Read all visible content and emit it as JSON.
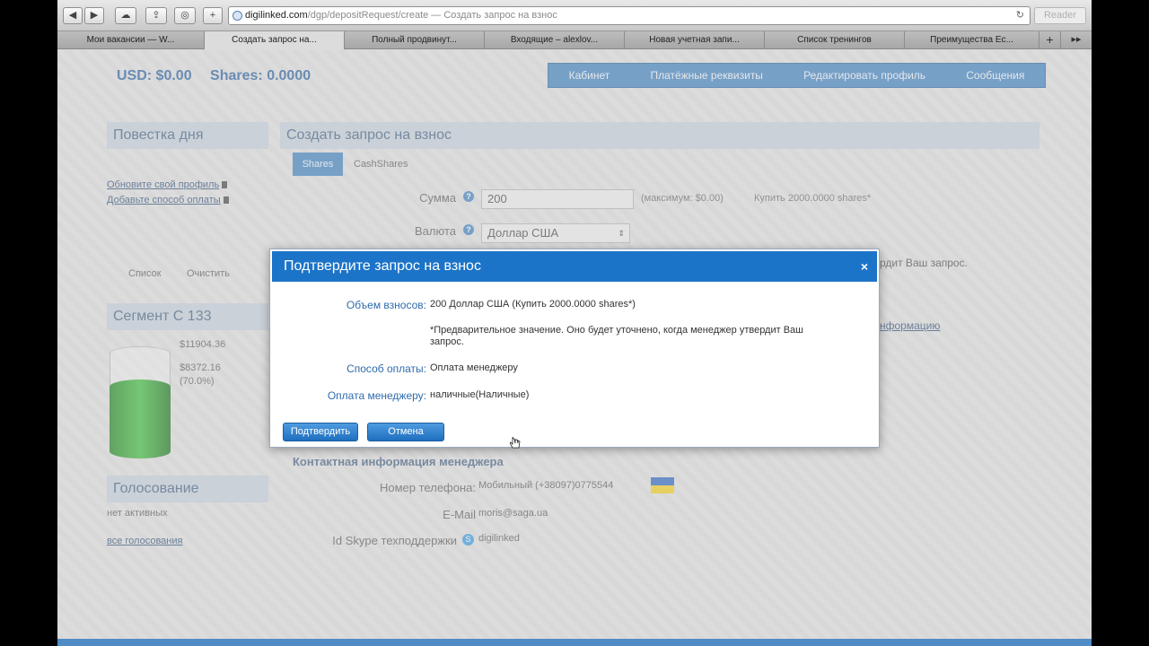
{
  "browser": {
    "url_host": "digilinked.com",
    "url_rest": "/dgp/depositRequest/create — Создать запрос на взнос",
    "reader_label": "Reader",
    "tabs": [
      {
        "label": "Мои вакансии — W..."
      },
      {
        "label": "Создать запрос на..."
      },
      {
        "label": "Полный продвинут..."
      },
      {
        "label": "Входящие – alexlov..."
      },
      {
        "label": "Новая учетная запи..."
      },
      {
        "label": "Список тренингов"
      },
      {
        "label": "Преимущества Ec..."
      }
    ],
    "new_tab_label": "+"
  },
  "header": {
    "usd": "USD: $0.00",
    "shares": "Shares: 0.0000"
  },
  "topnav": [
    "Кабинет",
    "Платёжные реквизиты",
    "Редактировать профиль",
    "Сообщения"
  ],
  "sidebar": {
    "agenda_title": "Повестка дня",
    "agenda_links": [
      "Обновите свой профиль",
      "Добавьте способ оплаты"
    ],
    "list_link": "Список",
    "clear_link": "Очистить",
    "segment_title": "Сегмент С 133",
    "segment_total": "$11904.36",
    "segment_filled": "$8372.16",
    "segment_percent": "(70.0%)",
    "segment_fill_fraction": 0.7,
    "voting_title": "Голосование",
    "voting_none": "нет активных",
    "voting_all": "все голосования"
  },
  "main": {
    "title": "Создать запрос на взнос",
    "tabs": [
      "Shares",
      "CashShares"
    ],
    "amount_label": "Сумма",
    "amount_value": "200",
    "amount_note": "(максимум: $0.00)",
    "amount_buy": "Купить 2000.0000 shares*",
    "currency_label": "Валюта",
    "currency_value": "Доллар США",
    "behind_text_1": "рдит Ваш запрос.",
    "behind_text_2": "нформацию",
    "contact_title": "Контактная информация менеджера",
    "phone_label": "Номер телефона:",
    "phone_value": "Мобильный (+38097)0775544",
    "email_label": "E-Mail",
    "email_value": "moris@saga.ua",
    "skype_label": "Id Skype техподдержки",
    "skype_value": "digilinked"
  },
  "modal": {
    "title": "Подтвердите запрос на взнос",
    "close": "×",
    "rows": [
      {
        "label": "Объем взносов:",
        "value": "200 Доллар США (Купить 2000.0000 shares*)"
      },
      {
        "label": "Способ оплаты:",
        "value": "Оплата менеджеру"
      },
      {
        "label": "Оплата менеджеру:",
        "value": "наличные(Наличные)"
      }
    ],
    "note": "*Предварительное значение. Оно будет уточнено, когда менеджер утвердит Ваш запрос.",
    "confirm_label": "Подтвердить",
    "cancel_label": "Отмена"
  }
}
